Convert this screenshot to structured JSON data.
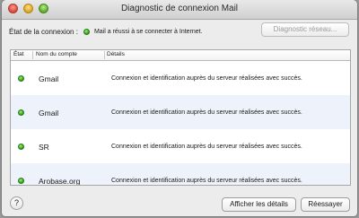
{
  "window": {
    "title": "Diagnostic de connexion Mail"
  },
  "status": {
    "label": "État de la connexion :",
    "text": "Mail a réussi à se connecter à Internet."
  },
  "buttons": {
    "network_diag": "Diagnostic réseau...",
    "show_details": "Afficher les détails",
    "retry": "Réessayer",
    "help": "?"
  },
  "table": {
    "columns": [
      "État",
      "Nom du compte",
      "Détails"
    ],
    "rows": [
      {
        "state": "connected",
        "name": "Gmail",
        "detail": "Connexion et identification auprès du serveur réalisées avec succès."
      },
      {
        "state": "connected",
        "name": "Gmail",
        "detail": "Connexion et identification auprès du serveur réalisées avec succès."
      },
      {
        "state": "connected",
        "name": "SR",
        "detail": "Connexion et identification auprès du serveur réalisées avec succès."
      },
      {
        "state": "connected",
        "name": "Arobase.org",
        "detail": "Connexion et identification auprès du serveur réalisées avec succès."
      }
    ]
  },
  "colors": {
    "status_ok": "#2f9a1c",
    "row_alt": "#eef3fb"
  }
}
